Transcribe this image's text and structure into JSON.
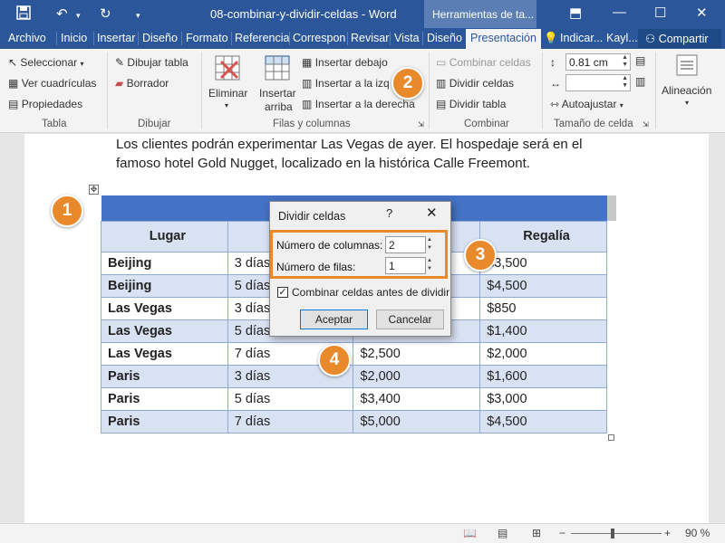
{
  "titlebar": {
    "doc_title": "08-combinar-y-dividir-celdas  -  Word",
    "context_tools": "Herramientas de ta...",
    "icons": [
      "save-icon",
      "undo-icon",
      "redo-icon",
      "ribbon-display-icon",
      "minimize-icon",
      "maximize-icon",
      "close-icon"
    ]
  },
  "tabs": {
    "items": [
      "Archivo",
      "Inicio",
      "Insertar",
      "Diseño",
      "Formato",
      "Referencia",
      "Correspon",
      "Revisar",
      "Vista",
      "Diseño",
      "Presentación"
    ],
    "active": "Presentación",
    "tell_me": "Indicar...",
    "user": "Kayl...",
    "share": "Compartir"
  },
  "ribbon": {
    "tabla": {
      "label": "Tabla",
      "seleccionar": "Seleccionar",
      "ver_cuadriculas": "Ver cuadrículas",
      "propiedades": "Propiedades"
    },
    "dibujar": {
      "label": "Dibujar",
      "dibujar_tabla": "Dibujar tabla",
      "borrador": "Borrador"
    },
    "filas": {
      "label": "Filas y columnas",
      "eliminar": "Eliminar",
      "insertar": "Insertar",
      "arriba": "arriba",
      "insertar_debajo": "Insertar debajo",
      "insertar_izq": "Insertar a la izq",
      "insertar_der": "Insertar a la derecha"
    },
    "combinar": {
      "label": "Combinar",
      "combinar_celdas": "Combinar celdas",
      "dividir_celdas": "Dividir celdas",
      "dividir_tabla": "Dividir tabla"
    },
    "tamano": {
      "label": "Tamaño de celda",
      "height_value": "0.81 cm",
      "width_value": "",
      "autoajustar": "Autoajustar"
    },
    "alineacion": {
      "label": "Alineación"
    }
  },
  "document": {
    "paragraph": "Los clientes podrán experimentar Las Vegas de ayer. El hospedaje será en el famoso hotel Gold Nugget, localizado en la histórica Calle Freemont.",
    "table": {
      "headers": [
        "Lugar",
        "D",
        "",
        "Regalía"
      ],
      "rows": [
        [
          "Beijing",
          "3 días",
          "",
          "$3,500"
        ],
        [
          "Beijing",
          "5 días",
          "",
          "$4,500"
        ],
        [
          "Las Vegas",
          "3 días",
          "",
          "$850"
        ],
        [
          "Las Vegas",
          "5 días",
          "",
          "$1,400"
        ],
        [
          "Las Vegas",
          "7 días",
          "$2,500",
          "$2,000"
        ],
        [
          "Paris",
          "3 días",
          "$2,000",
          "$1,600"
        ],
        [
          "Paris",
          "5 días",
          "$3,400",
          "$3,000"
        ],
        [
          "Paris",
          "7 días",
          "$5,000",
          "$4,500"
        ]
      ]
    }
  },
  "dialog": {
    "title": "Dividir celdas",
    "help": "?",
    "close": "✕",
    "cols_label": "Número de columnas:",
    "cols_value": "2",
    "rows_label": "Número de filas:",
    "rows_value": "1",
    "merge_label": "Combinar celdas antes de dividir",
    "merge_checked": true,
    "ok": "Aceptar",
    "cancel": "Cancelar"
  },
  "markers": [
    "1",
    "2",
    "3",
    "4"
  ],
  "status": {
    "zoom": "90 %"
  },
  "colors": {
    "word_blue": "#2b579a",
    "accent_orange": "#e8892c",
    "table_header": "#d9e2f3",
    "table_band": "#4472c4"
  }
}
